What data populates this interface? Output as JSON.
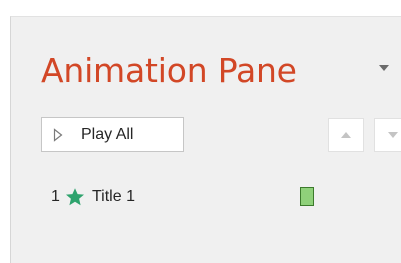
{
  "pane": {
    "title": "Animation Pane",
    "title_color": "#d24726",
    "background": "#f0f0f0"
  },
  "toolbar": {
    "play_all_label": "Play All",
    "play_icon": "play-triangle-icon",
    "move_up_icon": "triangle-up-icon",
    "move_down_icon": "triangle-down-icon",
    "dropdown_icon": "triangle-down-icon"
  },
  "animations": [
    {
      "number": "1",
      "effect_icon": "entrance-star-icon",
      "star_color": "#2ea36d",
      "name": "Title 1",
      "timing_bar_color": "#8fd17a"
    }
  ]
}
